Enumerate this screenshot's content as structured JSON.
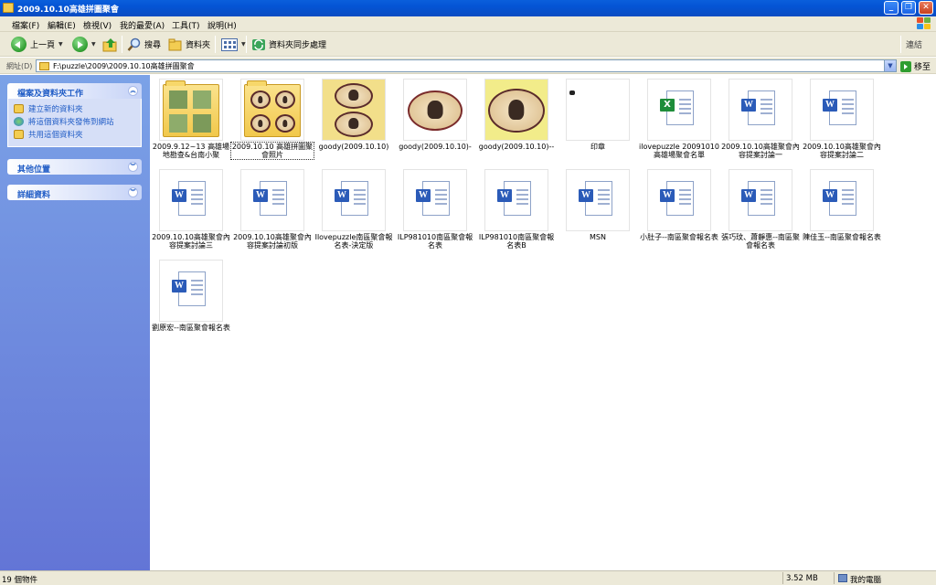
{
  "window": {
    "title": "2009.10.10高雄拼圖聚會"
  },
  "menu": [
    "檔案(F)",
    "編輯(E)",
    "檢視(V)",
    "我的最愛(A)",
    "工具(T)",
    "說明(H)"
  ],
  "toolbar": {
    "back": "上一頁",
    "search": "搜尋",
    "folders": "資料夾",
    "sync": "資料夾同步處理",
    "links": "連結"
  },
  "address": {
    "label": "網址(D)",
    "path": "F:\\puzzle\\2009\\2009.10.10高雄拼圖聚會",
    "go": "移至"
  },
  "tasks": {
    "file_folder": {
      "title": "檔案及資料夾工作",
      "items": [
        "建立新的資料夾",
        "將這個資料夾發佈到網站",
        "共用這個資料夾"
      ]
    },
    "other_places": {
      "title": "其他位置"
    },
    "details": {
      "title": "詳細資料"
    }
  },
  "files": [
    {
      "name": "2009.9.12~13 高雄場地勘查&台南小聚",
      "kind": "folder-photo"
    },
    {
      "name": "2009.10.10 高雄拼圖聚會照片",
      "kind": "folder-stamps",
      "selected": true
    },
    {
      "name": "goody(2009.10.10)",
      "kind": "image-stamps"
    },
    {
      "name": "goody(2009.10.10)-",
      "kind": "image-round"
    },
    {
      "name": "goody(2009.10.10)--",
      "kind": "image-wide"
    },
    {
      "name": "印章",
      "kind": "image-blank"
    },
    {
      "name": "ilovepuzzle 20091010高雄場聚會名單",
      "kind": "excel"
    },
    {
      "name": "2009.10.10高雄聚會內容提案討論一",
      "kind": "word"
    },
    {
      "name": "2009.10.10高雄聚會內容提案討論二",
      "kind": "word"
    },
    {
      "name": "2009.10.10高雄聚會內容提案討論三",
      "kind": "word"
    },
    {
      "name": "2009.10.10高雄聚會內容提案討論初版",
      "kind": "word"
    },
    {
      "name": "Ilovepuzzle南區聚會報名表-決定版",
      "kind": "word"
    },
    {
      "name": "ILP981010南區聚會報名表",
      "kind": "word"
    },
    {
      "name": "ILP981010南區聚會報名表B",
      "kind": "word"
    },
    {
      "name": "MSN",
      "kind": "word"
    },
    {
      "name": "小肚子--南區聚會報名表",
      "kind": "word"
    },
    {
      "name": "張巧玟、蕭靜惠--南區聚會報名表",
      "kind": "word"
    },
    {
      "name": "陳佳玉--南區聚會報名表",
      "kind": "word"
    },
    {
      "name": "劉原宏--南區聚會報名表",
      "kind": "word"
    }
  ],
  "status": {
    "count": "19 個物件",
    "size": "3.52 MB",
    "location": "我的電腦"
  }
}
